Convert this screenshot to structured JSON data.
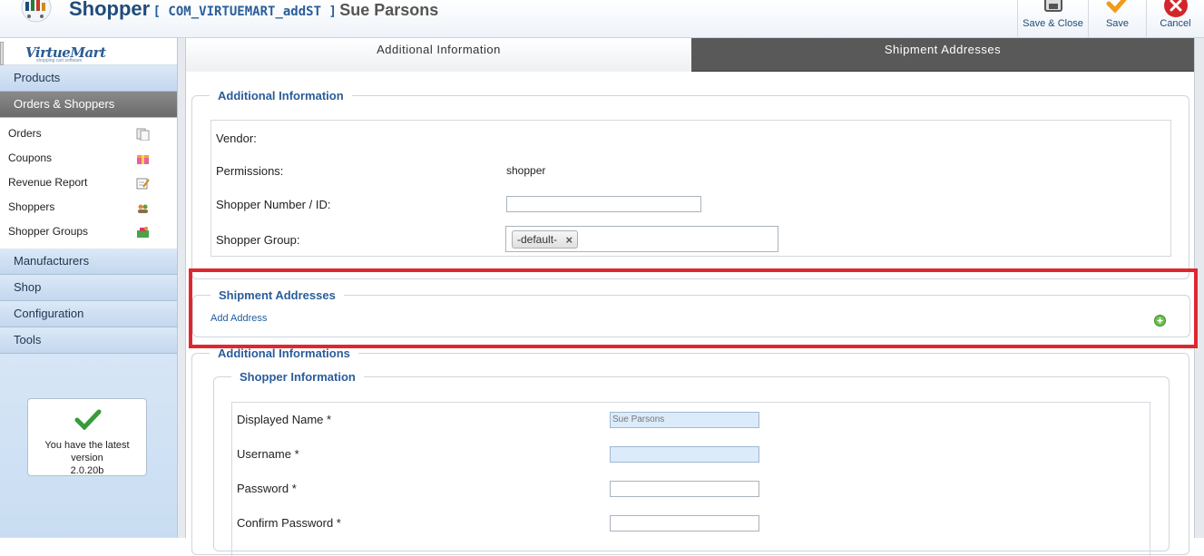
{
  "header": {
    "title": "Shopper",
    "component": "[ COM_VIRTUEMART_addST ]",
    "shopper_name": "Sue Parsons",
    "buttons": {
      "save_close": "Save & Close",
      "save": "Save",
      "cancel": "Cancel"
    }
  },
  "sidebar": {
    "logo_text": "VirtueMart",
    "logo_subtext": "shopping cart software",
    "sections": {
      "products": "Products",
      "orders_shoppers": "Orders & Shoppers",
      "manufacturers": "Manufacturers",
      "shop": "Shop",
      "configuration": "Configuration",
      "tools": "Tools"
    },
    "subitems": {
      "orders": "Orders",
      "coupons": "Coupons",
      "revenue_report": "Revenue Report",
      "shoppers": "Shoppers",
      "shopper_groups": "Shopper Groups"
    },
    "version": {
      "line1": "You have the latest",
      "line2": "version",
      "number": "2.0.20b"
    }
  },
  "tabs": {
    "additional_information": "Additional Information",
    "shipment_addresses": "Shipment Addresses"
  },
  "additional_info": {
    "legend": "Additional Information",
    "vendor_label": "Vendor:",
    "permissions_label": "Permissions:",
    "permissions_value": "shopper",
    "shopper_number_label": "Shopper Number / ID:",
    "shopper_number_value": "",
    "shopper_group_label": "Shopper Group:",
    "shopper_group_chip": "-default-",
    "chip_remove": "×"
  },
  "shipment": {
    "legend": "Shipment Addresses",
    "add_address": "Add Address"
  },
  "additional_informations": {
    "legend": "Additional Informations"
  },
  "shopper_info": {
    "legend": "Shopper Information",
    "displayed_name_label": "Displayed Name *",
    "displayed_name_value": "Sue Parsons",
    "username_label": "Username *",
    "username_value": "",
    "password_label": "Password *",
    "confirm_password_label": "Confirm Password *"
  },
  "colors": {
    "accent": "#2a5d99",
    "highlight_frame": "#e0262f",
    "active_tab": "#595959"
  }
}
